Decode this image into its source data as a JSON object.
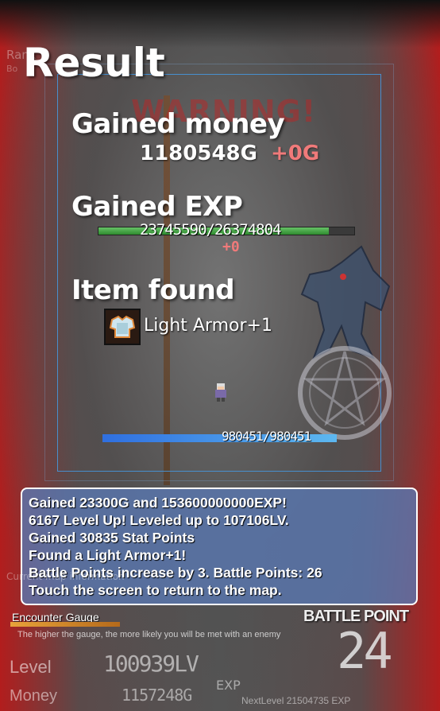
{
  "screen": {
    "title": "Result",
    "background_banner": "WARNING!",
    "background_rank": "Rank",
    "background_rank_sub": "Bo"
  },
  "money": {
    "heading": "Gained money",
    "value": "1180548G",
    "gain": "+0G"
  },
  "exp": {
    "heading": "Gained EXP",
    "value": "23745590/26374804",
    "gain": "+0",
    "progress": 0.9
  },
  "item": {
    "heading": "Item found",
    "name": "Light Armor+1",
    "icon": "armor-icon"
  },
  "hp": {
    "value": "980451/980451",
    "progress": 1.0
  },
  "message": {
    "lines": [
      "Gained 23300G and 153600000000EXP!",
      "6167 Level Up! Leveled up to 107106LV.",
      "Gained 30835 Stat Points",
      "Found a Light Armor+1!",
      "Battle Points increase by 3. Battle Points: 26",
      "Touch the screen to return to the map."
    ]
  },
  "status": {
    "current_map": "Current map information",
    "encounter_label": "Encounter Gauge",
    "encounter_note": "The higher the gauge, the more likely you will be met with an enemy",
    "battle_point_label": "BATTLE POINT",
    "battle_point_value": "24",
    "level_label": "Level",
    "level_value": "100939LV",
    "money_label": "Money",
    "money_value": "1157248G",
    "exp_label": "EXP",
    "next_level": "NextLevel  21504735 EXP"
  },
  "colors": {
    "accent_gain": "#f07a7a",
    "exp_bar": "#2e8b2e",
    "hp_bar": "#3b86e6",
    "message_bg": "#5a78b4",
    "frame_red": "#b21d1d"
  }
}
